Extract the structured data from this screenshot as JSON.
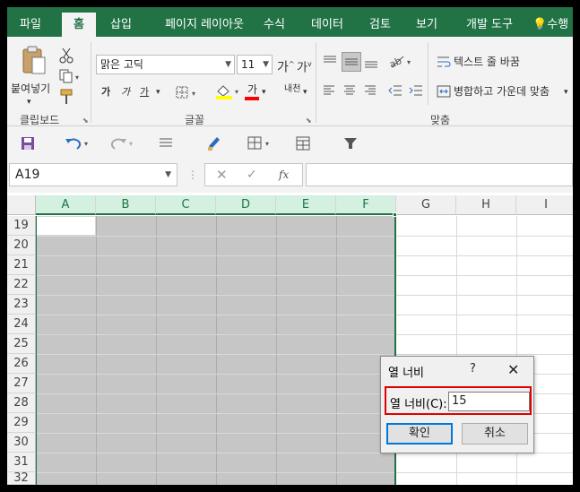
{
  "ribbon_tabs": [
    {
      "label": "파일"
    },
    {
      "label": "홈"
    },
    {
      "label": "삽입"
    },
    {
      "label": "페이지 레이아웃"
    },
    {
      "label": "수식"
    },
    {
      "label": "데이터"
    },
    {
      "label": "검토"
    },
    {
      "label": "보기"
    },
    {
      "label": "개발 도구"
    },
    {
      "label": "수행"
    }
  ],
  "ribbon": {
    "paste_label": "붙여넣기",
    "clipboard_group": "클립보드",
    "font_name": "맑은 고딕",
    "font_size": "11",
    "font_group": "글꼴",
    "bold": "가",
    "italic": "가",
    "underline": "가",
    "font_color_glyph": "가",
    "phonetic_glyph": "내천",
    "grow_font": "가",
    "shrink_font": "가",
    "wrap_text": "텍스트 줄 바꿈",
    "merge_center": "병합하고 가운데 맞춤",
    "alignment_group": "맞춤"
  },
  "formula_bar": {
    "name_box": "A19",
    "fx": "fx",
    "formula": ""
  },
  "grid": {
    "columns": [
      "A",
      "B",
      "C",
      "D",
      "E",
      "F",
      "G",
      "H",
      "I"
    ],
    "selected_columns": [
      "A",
      "B",
      "C",
      "D",
      "E",
      "F"
    ],
    "rows": [
      "19",
      "20",
      "21",
      "22",
      "23",
      "24",
      "25",
      "26",
      "27",
      "28",
      "29",
      "30",
      "31",
      "32"
    ]
  },
  "dialog": {
    "title": "열 너비",
    "help": "?",
    "field_label": "열 너비(C):",
    "field_value": "15",
    "ok_label": "확인",
    "cancel_label": "취소"
  },
  "colors": {
    "ribbon_green": "#217346",
    "selection_gray": "#c6c6c6",
    "highlight_red": "#e00000",
    "font_color_red": "#ff0000",
    "fill_yellow": "#ffff00"
  }
}
